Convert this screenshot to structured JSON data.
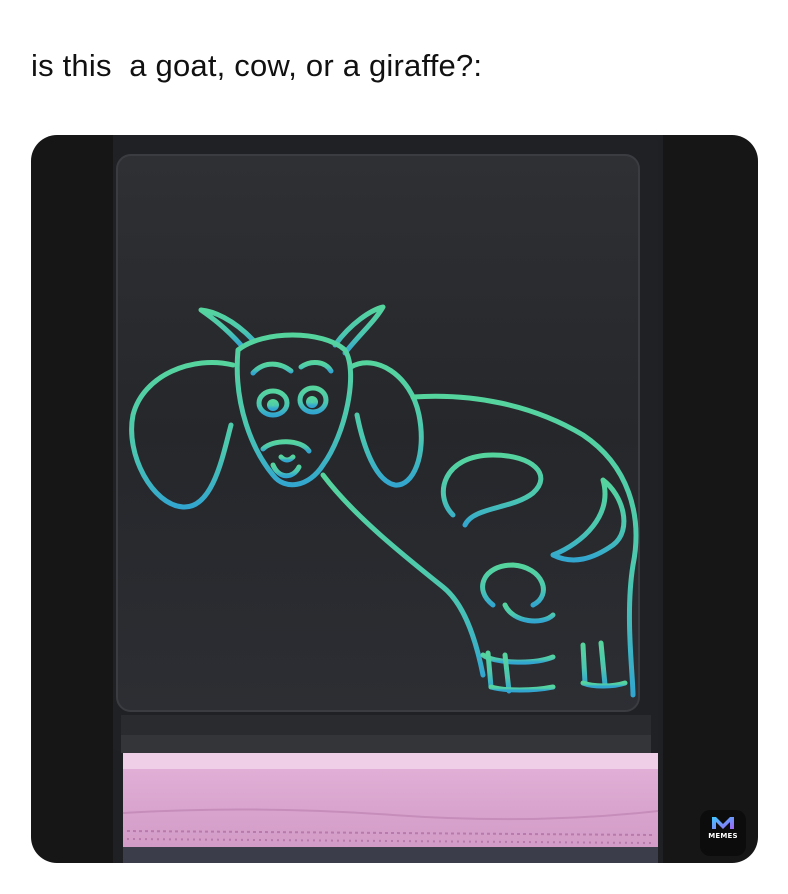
{
  "caption": "is this  a goat, cow, or a giraffe?:",
  "image": {
    "subject": "cow-doodle-on-drawing-tablet",
    "ink_color": "#4fd3a0",
    "ink_color_lower": "#3aa9c9",
    "tablet_color": "#2a2b2f",
    "cloth_color": "#d8a6d0"
  },
  "watermark": {
    "label": "MEMES",
    "icon": "memes-logo-icon"
  }
}
